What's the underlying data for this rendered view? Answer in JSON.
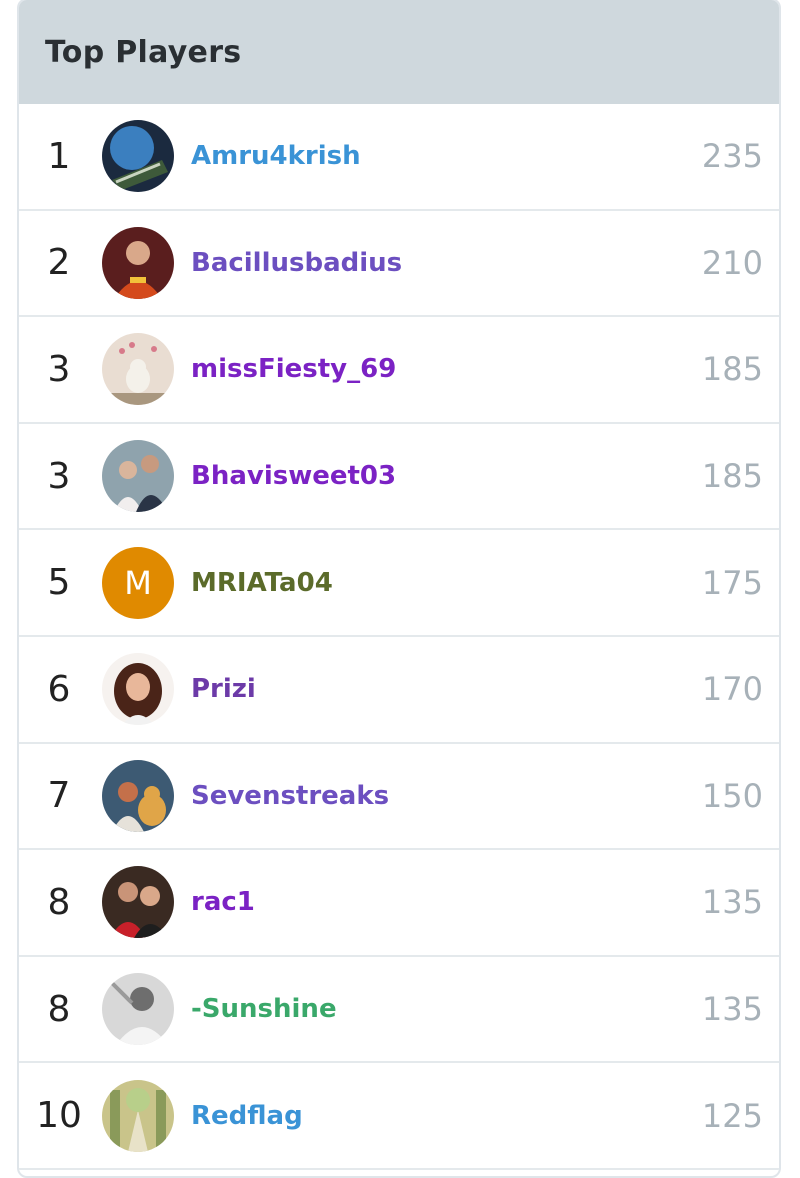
{
  "leaderboard": {
    "title": "Top Players",
    "players": [
      {
        "rank": "1",
        "name": "Amru4krish",
        "score": "235",
        "name_color": "#3a93d6",
        "avatar": "photo-avatar"
      },
      {
        "rank": "2",
        "name": "Bacillusbadius",
        "score": "210",
        "name_color": "#6c4fc0",
        "avatar": "photo-avatar"
      },
      {
        "rank": "3",
        "name": "missFiesty_69",
        "score": "185",
        "name_color": "#7b22c4",
        "avatar": "photo-avatar"
      },
      {
        "rank": "3",
        "name": "Bhavisweet03",
        "score": "185",
        "name_color": "#7b22c4",
        "avatar": "photo-avatar"
      },
      {
        "rank": "5",
        "name": "MRIATa04",
        "score": "175",
        "name_color": "#5b6b2a",
        "avatar": "letter-avatar",
        "avatar_letter": "M",
        "avatar_color": "#e08a00"
      },
      {
        "rank": "6",
        "name": "Prizi",
        "score": "170",
        "name_color": "#6c3aa8",
        "avatar": "photo-avatar"
      },
      {
        "rank": "7",
        "name": "Sevenstreaks",
        "score": "150",
        "name_color": "#6c4fc0",
        "avatar": "photo-avatar"
      },
      {
        "rank": "8",
        "name": "rac1",
        "score": "135",
        "name_color": "#7b22c4",
        "avatar": "photo-avatar"
      },
      {
        "rank": "8",
        "name": "-Sunshine",
        "score": "135",
        "name_color": "#3aa86a",
        "avatar": "photo-avatar"
      },
      {
        "rank": "10",
        "name": "Redflag",
        "score": "125",
        "name_color": "#3a93d6",
        "avatar": "photo-avatar"
      }
    ]
  }
}
